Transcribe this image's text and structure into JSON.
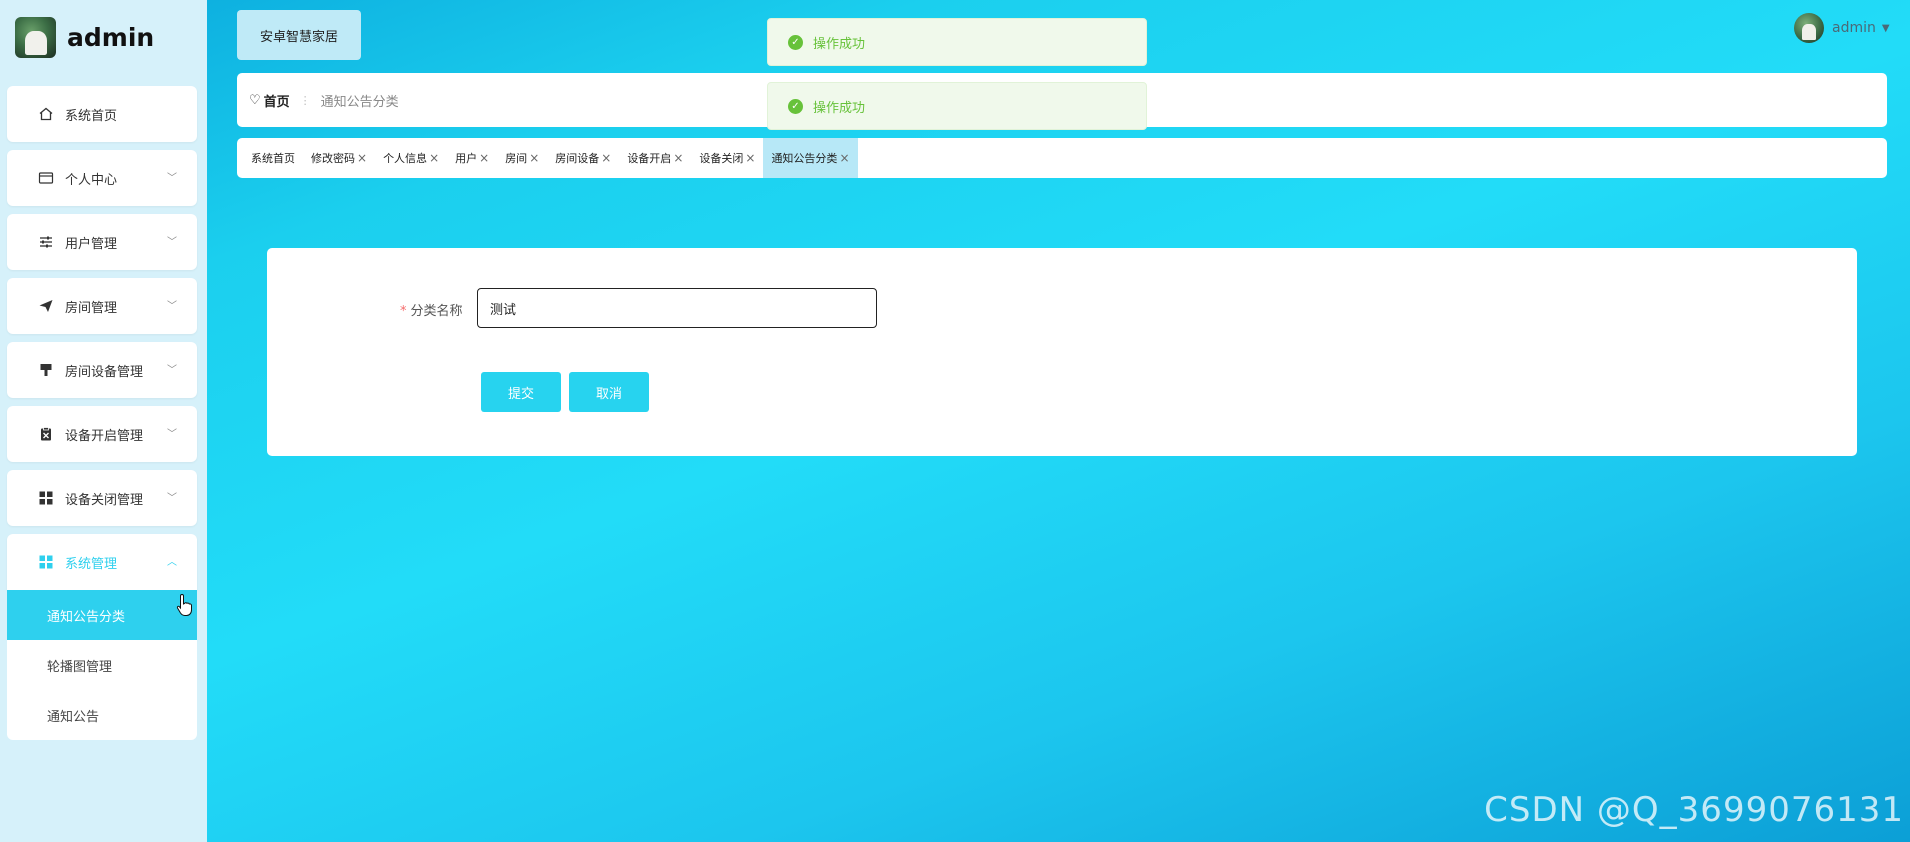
{
  "app": {
    "title": "安卓智慧家居"
  },
  "brand": {
    "name": "admin"
  },
  "user": {
    "name": "admin"
  },
  "sidebar": {
    "items": [
      {
        "label": "系统首页",
        "icon": "home-icon"
      },
      {
        "label": "个人中心",
        "icon": "card-icon"
      },
      {
        "label": "用户管理",
        "icon": "sliders-icon"
      },
      {
        "label": "房间管理",
        "icon": "send-icon"
      },
      {
        "label": "房间设备管理",
        "icon": "brush-icon"
      },
      {
        "label": "设备开启管理",
        "icon": "clipboard-icon"
      },
      {
        "label": "设备关闭管理",
        "icon": "grid-icon"
      },
      {
        "label": "系统管理",
        "icon": "grid-icon"
      }
    ],
    "submenu": [
      {
        "label": "通知公告分类"
      },
      {
        "label": "轮播图管理"
      },
      {
        "label": "通知公告"
      }
    ]
  },
  "breadcrumb": {
    "home": "首页",
    "current": "通知公告分类"
  },
  "tabs": [
    {
      "label": "系统首页"
    },
    {
      "label": "修改密码"
    },
    {
      "label": "个人信息"
    },
    {
      "label": "用户"
    },
    {
      "label": "房间"
    },
    {
      "label": "房间设备"
    },
    {
      "label": "设备开启"
    },
    {
      "label": "设备关闭"
    },
    {
      "label": "通知公告分类"
    }
  ],
  "notifications": [
    {
      "text": "操作成功"
    },
    {
      "text": "操作成功"
    }
  ],
  "form": {
    "category_label": "分类名称",
    "category_value": "测试",
    "submit_label": "提交",
    "cancel_label": "取消"
  },
  "watermark": "CSDN @Q_3699076131",
  "colors": {
    "accent": "#27d3ef",
    "success": "#67c23a",
    "required": "#f56c6c"
  }
}
